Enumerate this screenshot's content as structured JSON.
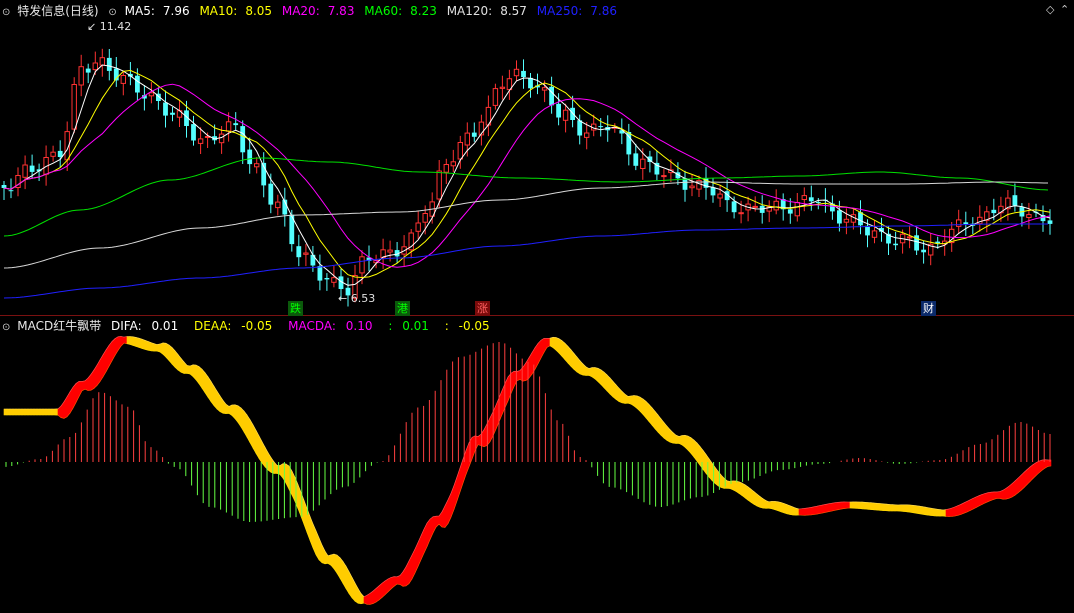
{
  "app": {
    "title": "特发信息(日线)"
  },
  "main_pane": {
    "indicators": [
      {
        "label": "MA5:",
        "value": "7.96",
        "color": "#ffffff"
      },
      {
        "label": "MA10:",
        "value": "8.05",
        "color": "#ffff00"
      },
      {
        "label": "MA20:",
        "value": "7.83",
        "color": "#ff00ff"
      },
      {
        "label": "MA60:",
        "value": "8.23",
        "color": "#00ff00"
      },
      {
        "label": "MA120:",
        "value": "8.57",
        "color": "#e0e0e0"
      },
      {
        "label": "MA250:",
        "value": "7.86",
        "color": "#2020ff"
      }
    ],
    "high_label": "11.42",
    "low_label": "6.53",
    "event_markers": [
      {
        "text": "跌",
        "color": "#00ff00",
        "bg": "#0b5a0b"
      },
      {
        "text": "港",
        "color": "#00ff00",
        "bg": "#0b5a0b"
      },
      {
        "text": "涨",
        "color": "#ff6060",
        "bg": "#7a0b0b"
      },
      {
        "text": "财",
        "color": "#ffffff",
        "bg": "#0b2a6a"
      }
    ]
  },
  "macd_pane": {
    "title": "MACD红牛飘带",
    "indicators": [
      {
        "label": "DIFA:",
        "value": "0.01",
        "color": "#ffffff"
      },
      {
        "label": "DEAA:",
        "value": "-0.05",
        "color": "#ffff00"
      },
      {
        "label": "MACDA:",
        "value": "0.10",
        "color": "#ff00ff"
      },
      {
        "label": ":",
        "value": "0.01",
        "color": "#00ff00"
      },
      {
        "label": ":",
        "value": "-0.05",
        "color": "#ffff00"
      }
    ]
  },
  "icons": [
    "diamond-icon",
    "chevron-up-icon",
    "pane-toggle-icon"
  ],
  "colors": {
    "up": "#ff3232",
    "down": "#54ffff",
    "ribbon_up": "#ff0000",
    "ribbon_down": "#ffcc00",
    "hist_pos": "#ff4040",
    "hist_neg": "#66ff44",
    "divider": "#7a1111"
  }
}
